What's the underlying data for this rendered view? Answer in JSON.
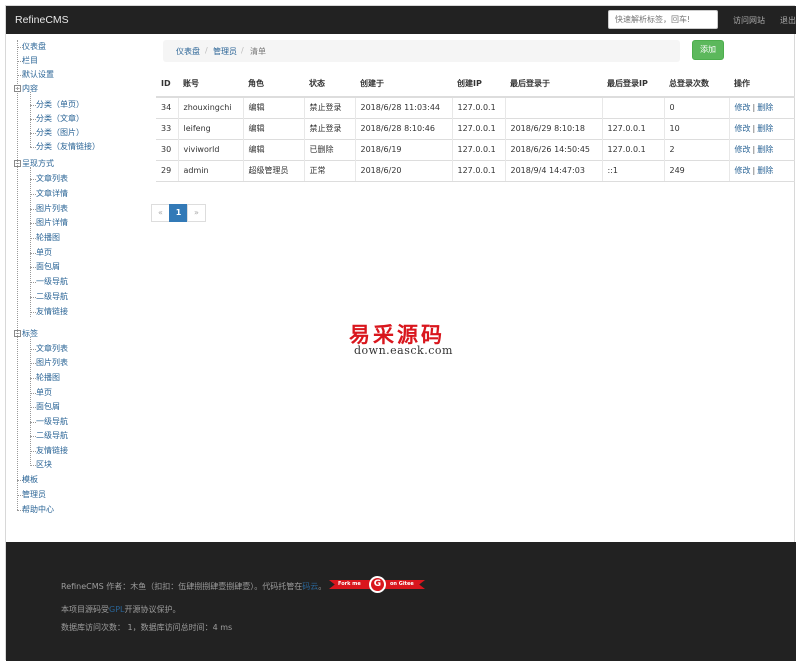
{
  "navbar": {
    "brand": "RefineCMS",
    "search_placeholder": "快速解析标签，回车!",
    "visit_site": "访问网站",
    "logout": "退出"
  },
  "sidebar": {
    "dashboard": "仪表盘",
    "columns": "栏目",
    "default_settings": "默认设置",
    "content": {
      "label": "内容",
      "children": [
        "分类（单页）",
        "分类（文章）",
        "分类（图片）",
        "分类（友情链接）"
      ]
    },
    "presentation": {
      "label": "呈现方式",
      "children": [
        "文章列表",
        "文章详情",
        "图片列表",
        "图片详情",
        "轮播图",
        "单页",
        "面包屑",
        "一级导航",
        "二级导航",
        "友情链接"
      ]
    },
    "tags": {
      "label": "标签",
      "children": [
        "文章列表",
        "图片列表",
        "轮播图",
        "单页",
        "面包屑",
        "一级导航",
        "二级导航",
        "友情链接",
        "区块"
      ]
    },
    "templates": "模板",
    "admins": "管理员",
    "help": "帮助中心"
  },
  "breadcrumb": {
    "home": "仪表盘",
    "section": "管理员",
    "current": "清单"
  },
  "actions": {
    "add": "添加"
  },
  "table": {
    "headers": [
      "ID",
      "账号",
      "角色",
      "状态",
      "创建于",
      "创建IP",
      "最后登录于",
      "最后登录IP",
      "总登录次数",
      "操作"
    ],
    "rows": [
      [
        "34",
        "zhouxingchi",
        "编辑",
        "禁止登录",
        "2018/6/28 11:03:44",
        "127.0.0.1",
        "",
        "",
        "0"
      ],
      [
        "33",
        "leifeng",
        "编辑",
        "禁止登录",
        "2018/6/28 8:10:46",
        "127.0.0.1",
        "2018/6/29 8:10:18",
        "127.0.0.1",
        "10"
      ],
      [
        "30",
        "viviworld",
        "编辑",
        "已删除",
        "2018/6/19",
        "127.0.0.1",
        "2018/6/26 14:50:45",
        "127.0.0.1",
        "2"
      ],
      [
        "29",
        "admin",
        "超级管理员",
        "正常",
        "2018/6/20",
        "127.0.0.1",
        "2018/9/4 14:47:03",
        "::1",
        "249"
      ]
    ],
    "edit_label": "修改",
    "op_separator": "|",
    "delete_label": "删除"
  },
  "pagination": {
    "prev": "«",
    "current": "1",
    "next": "»"
  },
  "watermark": {
    "title": "易采源码",
    "subtitle": "down.easck.com"
  },
  "footer": {
    "line1_prefix": "RefineCMS 作者：木鱼（扣扣：伍肆捌捌肆壹捌肆壹）。代码托管在",
    "line1_link": "码云",
    "line1_suffix": "。",
    "ribbon_left": "Fork me",
    "ribbon_badge": "G",
    "ribbon_right": "on Gitee",
    "line2_prefix": "本项目源码受",
    "line2_link": "GPL",
    "line2_suffix": "开源协议保护。",
    "line3": "数据库访问次数： 1，数据库访问总时间：4 ms"
  },
  "colors": {
    "navbar_bg": "#222222",
    "link": "#2a6496",
    "add_button": "#5cb85c",
    "pager_active": "#337ab7",
    "watermark_red": "#d9161d"
  }
}
